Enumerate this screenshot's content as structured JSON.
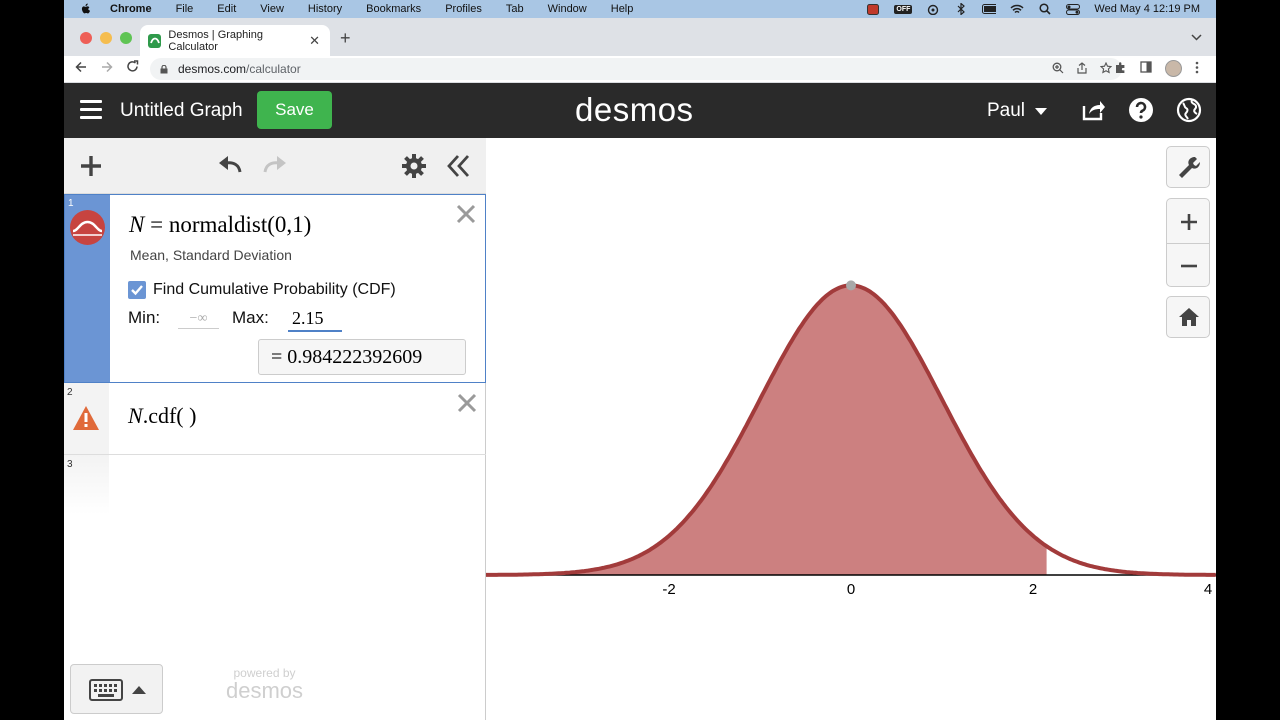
{
  "menubar": {
    "app": "Chrome",
    "items": [
      "File",
      "Edit",
      "View",
      "History",
      "Bookmarks",
      "Profiles",
      "Tab",
      "Window",
      "Help"
    ],
    "status_badge": "OFF",
    "datetime": "Wed May 4  12:19 PM"
  },
  "browser": {
    "tab_title": "Desmos | Graphing Calculator",
    "url_host": "desmos.com",
    "url_path": "/calculator"
  },
  "header": {
    "graph_title": "Untitled Graph",
    "save_label": "Save",
    "logo": "desmos",
    "user": "Paul"
  },
  "expressions": [
    {
      "index": "1",
      "latex_var": "N",
      "latex_eq": " = ",
      "latex_fn": "normaldist",
      "latex_args": "(0,1)",
      "params": [
        "Mean,",
        "Standard Deviation"
      ],
      "cdf_label": "Find Cumulative Probability (CDF)",
      "cdf_checked": true,
      "min_label": "Min:",
      "min_value": "−∞",
      "max_label": "Max:",
      "max_value": "2.15",
      "result": "=  0.984222392609"
    },
    {
      "index": "2",
      "latex_var": "N",
      "latex_rest": ".cdf(   )"
    },
    {
      "index": "3"
    }
  ],
  "footer": {
    "powered_by": "powered by",
    "powered_logo": "desmos"
  },
  "graph": {
    "mean": 0,
    "sd": 1,
    "cdf_max": 2.15,
    "x_tick_labels": [
      "-2",
      "0",
      "2",
      "4"
    ],
    "curve_color": "#a23b3b",
    "fill_color": "#cc8080"
  },
  "colors": {
    "accent": "#4f81c7",
    "save_green": "#3fb44e",
    "header_bg": "#2a2a2a",
    "dist_red": "#c74440",
    "warn_orange": "#e06a3a"
  }
}
